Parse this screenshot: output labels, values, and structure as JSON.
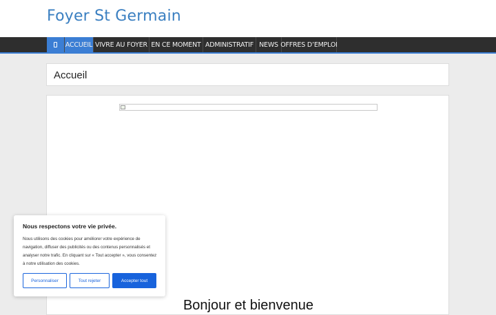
{
  "site": {
    "title": "Foyer St Germain"
  },
  "nav": {
    "home_icon": "home-icon",
    "items": [
      {
        "label": "ACCUEIL",
        "active": true
      },
      {
        "label": "VIVRE AU FOYER",
        "active": false
      },
      {
        "label": "EN CE MOMENT",
        "active": false
      },
      {
        "label": "ADMINISTRATIF",
        "active": false
      },
      {
        "label": "NEWS",
        "active": false
      },
      {
        "label": "OFFRES D’EMPLOI",
        "active": false
      }
    ]
  },
  "page": {
    "title": "Accueil",
    "welcome_heading": "Bonjour et bienvenue"
  },
  "cookie_banner": {
    "title": "Nous respectons votre vie privée.",
    "text": "Nous utilisons des cookies pour améliorer votre expérience de navigation, diffuser des publicités ou des contenus personnalisés et analyser notre trafic. En cliquant sur « Tout accepter », vous consentez à notre utilisation des cookies.",
    "customize_label": "Personnaliser",
    "reject_label": "Tout rejeter",
    "accept_label": "Accepter tout"
  },
  "colors": {
    "accent": "#3b7ed4",
    "title_blue": "#3a7fc1",
    "nav_background": "#2e2e2e",
    "page_background": "#ececec",
    "cookie_button_blue": "#1863dc"
  }
}
